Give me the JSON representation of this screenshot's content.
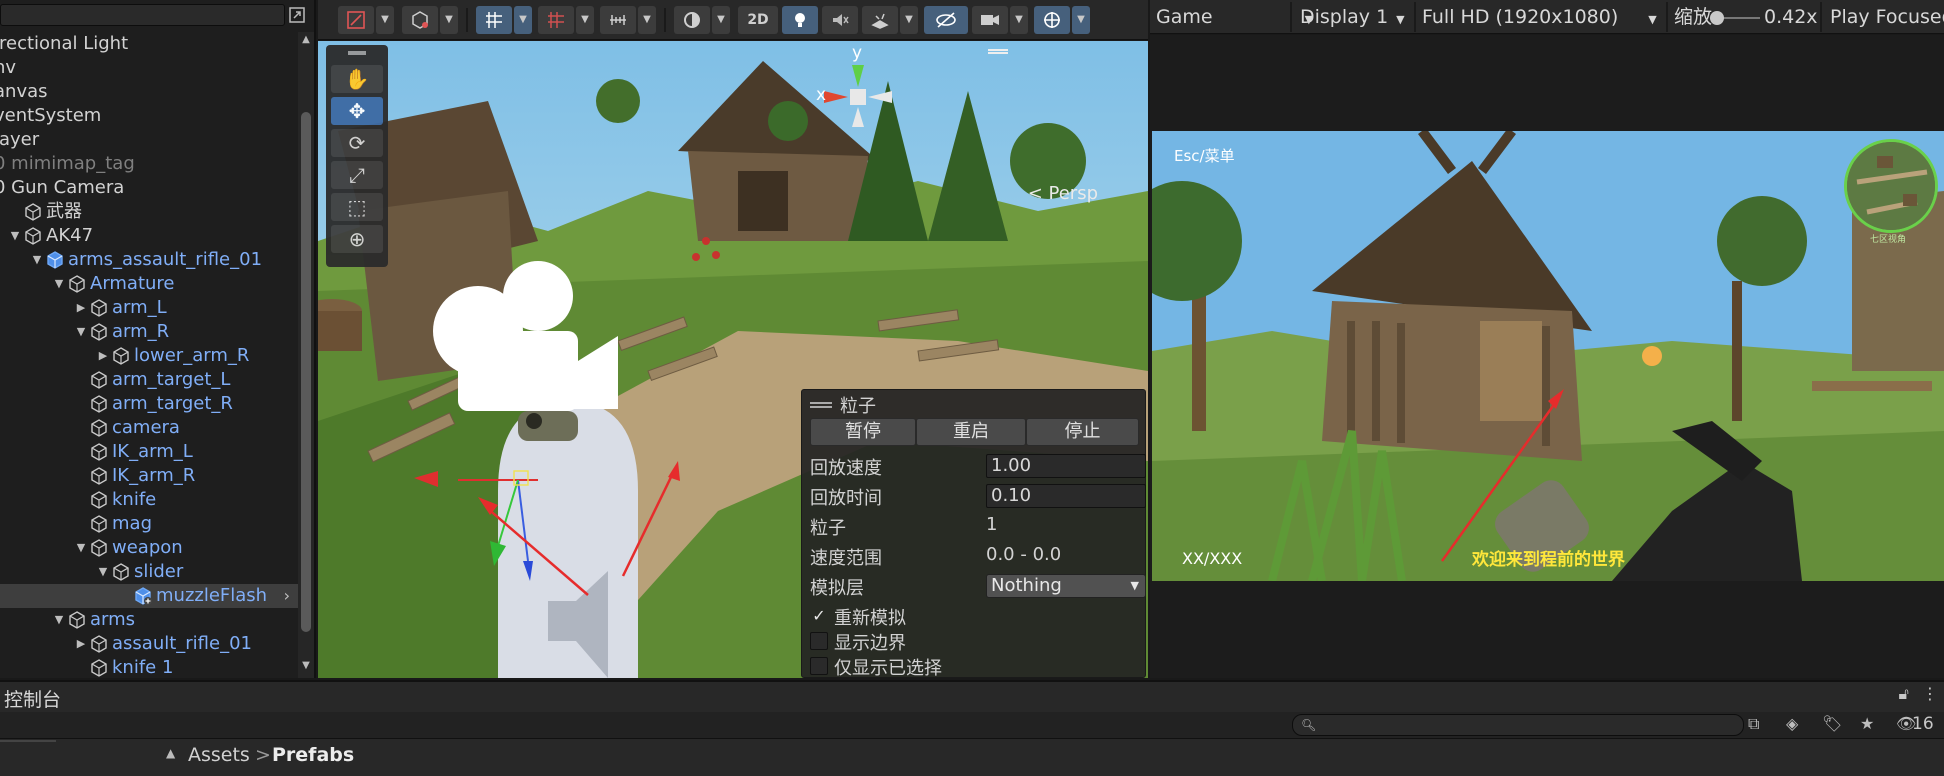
{
  "hierarchy": {
    "items": [
      {
        "label": "irectional Light",
        "indent": 0,
        "arrow": "",
        "kind": "plain"
      },
      {
        "label": "nv",
        "indent": 0,
        "arrow": "",
        "kind": "plain"
      },
      {
        "label": "anvas",
        "indent": 0,
        "arrow": "",
        "kind": "plain"
      },
      {
        "label": "ventSystem",
        "indent": 0,
        "arrow": "",
        "kind": "plain"
      },
      {
        "label": "layer",
        "indent": 0,
        "arrow": "",
        "kind": "plain"
      },
      {
        "label": "0 mimimap_tag",
        "indent": 0,
        "arrow": "",
        "kind": "dim"
      },
      {
        "label": "0 Gun Camera",
        "indent": 0,
        "arrow": "",
        "kind": "plain"
      },
      {
        "label": "武器",
        "indent": 1,
        "arrow": "",
        "kind": "plain",
        "icon": "cube"
      },
      {
        "label": "AK47",
        "indent": 1,
        "arrow": "down",
        "kind": "plain",
        "icon": "cube"
      },
      {
        "label": "arms_assault_rifle_01",
        "indent": 2,
        "arrow": "down",
        "kind": "prefab",
        "icon": "prefab-cube"
      },
      {
        "label": "Armature",
        "indent": 3,
        "arrow": "down",
        "kind": "prefab",
        "icon": "cube"
      },
      {
        "label": "arm_L",
        "indent": 4,
        "arrow": "right",
        "kind": "prefab",
        "icon": "cube"
      },
      {
        "label": "arm_R",
        "indent": 4,
        "arrow": "down",
        "kind": "prefab",
        "icon": "cube"
      },
      {
        "label": "lower_arm_R",
        "indent": 5,
        "arrow": "right",
        "kind": "prefab",
        "icon": "cube"
      },
      {
        "label": "arm_target_L",
        "indent": 4,
        "arrow": "",
        "kind": "prefab",
        "icon": "cube"
      },
      {
        "label": "arm_target_R",
        "indent": 4,
        "arrow": "",
        "kind": "prefab",
        "icon": "cube"
      },
      {
        "label": "camera",
        "indent": 4,
        "arrow": "",
        "kind": "prefab",
        "icon": "cube"
      },
      {
        "label": "IK_arm_L",
        "indent": 4,
        "arrow": "",
        "kind": "prefab",
        "icon": "cube"
      },
      {
        "label": "IK_arm_R",
        "indent": 4,
        "arrow": "",
        "kind": "prefab",
        "icon": "cube"
      },
      {
        "label": "knife",
        "indent": 4,
        "arrow": "",
        "kind": "prefab",
        "icon": "cube"
      },
      {
        "label": "mag",
        "indent": 4,
        "arrow": "",
        "kind": "prefab",
        "icon": "cube"
      },
      {
        "label": "weapon",
        "indent": 4,
        "arrow": "down",
        "kind": "prefab",
        "icon": "cube"
      },
      {
        "label": "slider",
        "indent": 5,
        "arrow": "down",
        "kind": "prefab",
        "icon": "cube"
      },
      {
        "label": "muzzleFlash",
        "indent": 6,
        "arrow": "",
        "kind": "selected",
        "icon": "prefab-add-cube"
      },
      {
        "label": "arms",
        "indent": 3,
        "arrow": "down",
        "kind": "prefab",
        "icon": "cube"
      },
      {
        "label": "assault_rifle_01",
        "indent": 4,
        "arrow": "right",
        "kind": "prefab",
        "icon": "cube"
      },
      {
        "label": "knife 1",
        "indent": 4,
        "arrow": "",
        "kind": "prefab",
        "icon": "cube"
      }
    ]
  },
  "scene_toolbar": {
    "btn_2d": "2D"
  },
  "scene": {
    "persp_label": "< Persp",
    "gizmo_x": "x",
    "gizmo_y": "y"
  },
  "particle_panel": {
    "title": "粒子",
    "pause_label": "暂停",
    "restart_label": "重启",
    "stop_label": "停止",
    "playback_speed_label": "回放速度",
    "playback_speed_value": "1.00",
    "playback_time_label": "回放时间",
    "playback_time_value": "0.10",
    "particles_label": "粒子",
    "particles_value": "1",
    "speed_range_label": "速度范围",
    "speed_range_value": "0.0 - 0.0",
    "sim_layer_label": "模拟层",
    "sim_layer_value": "Nothing",
    "resimulate_label": "重新模拟",
    "resimulate_checked": true,
    "show_bounds_label": "显示边界",
    "show_bounds_checked": false,
    "show_selected_label": "仅显示已选择",
    "show_selected_checked": false
  },
  "game_toolbar": {
    "view_label": "Game",
    "display_label": "Display 1",
    "resolution_label": "Full HD (1920x1080)",
    "zoom_label": "缩放",
    "zoom_value": "0.42x",
    "play_mode_label": "Play Focused"
  },
  "game": {
    "esc_hint": "Esc/菜单",
    "ammo_text": "XX/XXX",
    "welcome_text": "欢迎来到程前的世界",
    "minimap_label": "七区视角"
  },
  "console": {
    "title": "控制台"
  },
  "project": {
    "search_placeholder": "",
    "visible_count": "16",
    "breadcrumb_root": "Assets",
    "breadcrumb_sep": ">",
    "breadcrumb_current": "Prefabs"
  },
  "colors": {
    "accent_blue": "#3d6aa3",
    "prefab_text": "#80aef7",
    "welcome_yellow": "#ffe73b",
    "minimap_ring": "#6ad04a",
    "annotation_red": "#e62c2c"
  }
}
